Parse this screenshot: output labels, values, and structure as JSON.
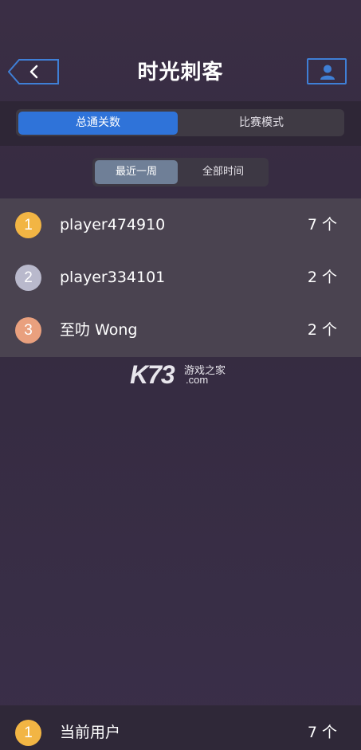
{
  "header": {
    "title": "时光刺客",
    "back_icon": "chevron-left-icon",
    "profile_icon": "user-icon",
    "accent": "#3f7fd6"
  },
  "tabs": [
    {
      "label": "总通关数",
      "active": true
    },
    {
      "label": "比赛模式",
      "active": false
    }
  ],
  "time_filter": [
    {
      "label": "最近一周",
      "active": true
    },
    {
      "label": "全部时间",
      "active": false
    }
  ],
  "leaderboard": [
    {
      "rank": "1",
      "name": "player474910",
      "score": "7 个",
      "badge_color": "#f2b544"
    },
    {
      "rank": "2",
      "name": "player334101",
      "score": "2 个",
      "badge_color": "#b9b9cc"
    },
    {
      "rank": "3",
      "name": "至叻 Wong",
      "score": "2 个",
      "badge_color": "#e9a07e"
    }
  ],
  "watermark": {
    "logo": "K73",
    "cn": "游戏之家",
    "domain": ".com"
  },
  "current_user": {
    "rank": "1",
    "name": "当前用户",
    "score": "7 个",
    "badge_color": "#f2b544"
  }
}
